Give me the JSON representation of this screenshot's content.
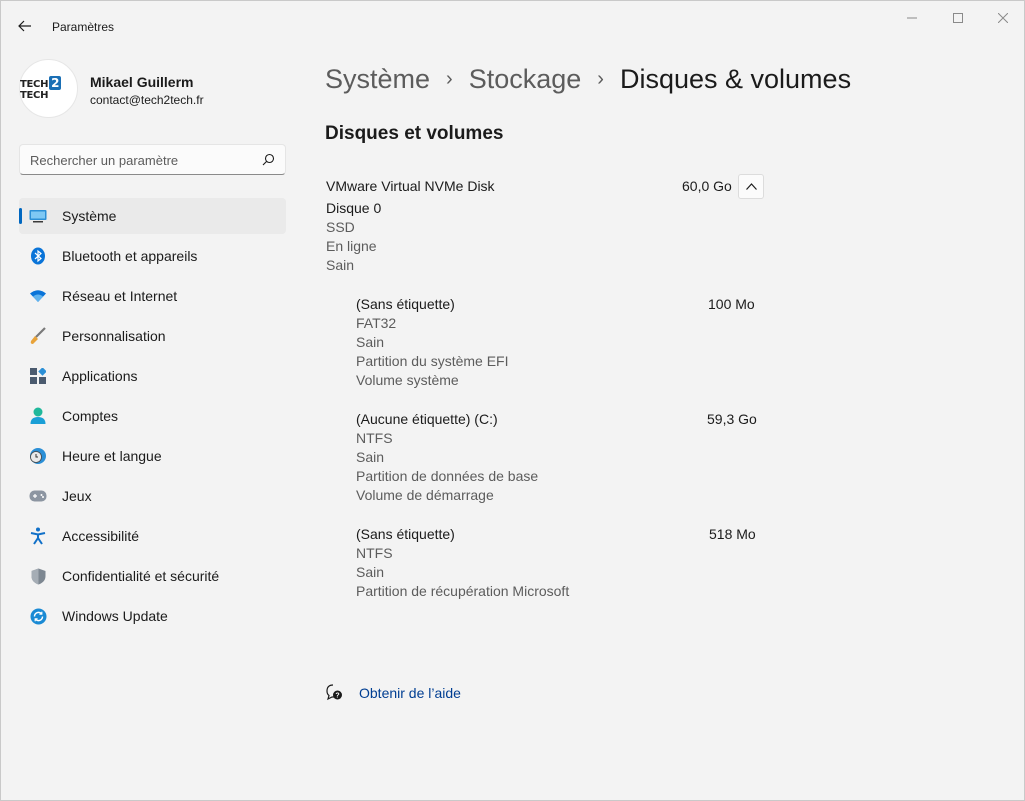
{
  "window": {
    "title": "Paramètres"
  },
  "user": {
    "name": "Mikael Guillerm",
    "email": "contact@tech2tech.fr",
    "logo_left": "TECH",
    "logo_mid": "2",
    "logo_right": "TECH"
  },
  "search": {
    "placeholder": "Rechercher un paramètre"
  },
  "sidebar": {
    "items": [
      {
        "label": "Système",
        "icon": "system-icon",
        "active": true
      },
      {
        "label": "Bluetooth et appareils",
        "icon": "bluetooth-icon"
      },
      {
        "label": "Réseau et Internet",
        "icon": "wifi-icon"
      },
      {
        "label": "Personnalisation",
        "icon": "brush-icon"
      },
      {
        "label": "Applications",
        "icon": "apps-icon"
      },
      {
        "label": "Comptes",
        "icon": "account-icon"
      },
      {
        "label": "Heure et langue",
        "icon": "clock-globe-icon"
      },
      {
        "label": "Jeux",
        "icon": "gamepad-icon"
      },
      {
        "label": "Accessibilité",
        "icon": "accessibility-icon"
      },
      {
        "label": "Confidentialité et sécurité",
        "icon": "shield-icon"
      },
      {
        "label": "Windows Update",
        "icon": "update-icon"
      }
    ]
  },
  "breadcrumb": {
    "item1": "Système",
    "item2": "Stockage",
    "current": "Disques & volumes"
  },
  "section": {
    "title": "Disques et volumes"
  },
  "disk": {
    "name": "VMware Virtual NVMe Disk",
    "size": "60,0 Go",
    "label": "Disque 0",
    "type": "SSD",
    "status": "En ligne",
    "health": "Sain"
  },
  "volumes": [
    {
      "name": "(Sans étiquette)",
      "size": "100 Mo",
      "fs": "FAT32",
      "health": "Sain",
      "partition": "Partition du système EFI",
      "role": "Volume système"
    },
    {
      "name": "(Aucune étiquette) (C:)",
      "size": "59,3 Go",
      "fs": "NTFS",
      "health": "Sain",
      "partition": "Partition de données de base",
      "role": "Volume de démarrage"
    },
    {
      "name": "(Sans étiquette)",
      "size": "518 Mo",
      "fs": "NTFS",
      "health": "Sain",
      "partition": "Partition de récupération Microsoft"
    }
  ],
  "help": {
    "label": "Obtenir de l’aide"
  },
  "colors": {
    "accent": "#0067c0",
    "link": "#003e92",
    "background": "#f3f3f3"
  }
}
